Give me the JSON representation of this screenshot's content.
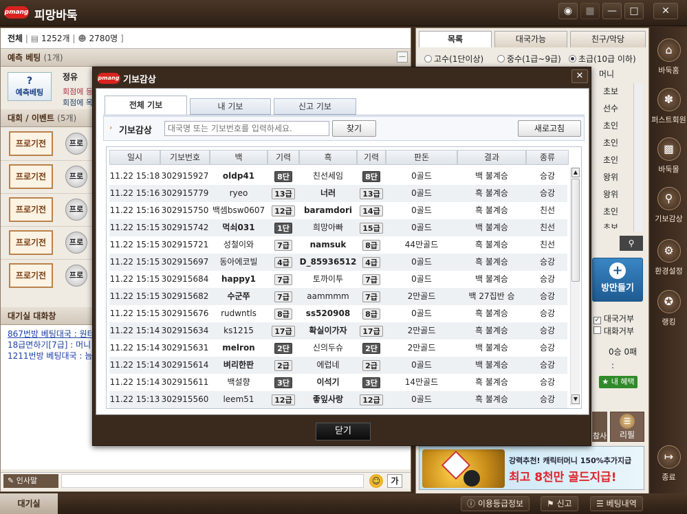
{
  "app": {
    "logo": "pmang",
    "title": "피망바둑"
  },
  "window_buttons": [
    "camera-icon",
    "grid-icon",
    "minimize-icon",
    "maximize-icon",
    "close-icon"
  ],
  "lobby": {
    "header_all": "전체",
    "count_label": "1252개",
    "user_label": "2780명",
    "prediction_title": "예측 베팅",
    "prediction_count": "(1개)",
    "prediction_button": "예측베팅",
    "prediction_user": "정유",
    "prediction_lines": [
      "회점에 등",
      "회점에 목"
    ],
    "events_title": "대회 / 이벤트",
    "events_count": "(5개)",
    "pro_buttons": [
      "프로기전",
      "프로기전",
      "프로기전",
      "프로기전",
      "프로기전"
    ],
    "pro_circles": [
      "프로",
      "프로",
      "프로",
      "프로",
      "프로"
    ],
    "chat_title": "대기실 대화창",
    "chat_lines": [
      "867번방 베팅대국 : 원터",
      "18급면하기[7급] : 머니",
      "1211번방 베팅대국 : 늠"
    ],
    "chat_input_label": "인사말",
    "chat_font_btn": "가",
    "footer_tab": "대기실"
  },
  "right": {
    "tabs": [
      "목록",
      "대국가능",
      "친구/악당"
    ],
    "filters": [
      {
        "label": "고수(1단이상)",
        "on": false
      },
      {
        "label": "중수(1급~9급)",
        "on": false
      },
      {
        "label": "초급(10급 이하)",
        "on": true
      }
    ],
    "col_header": "머니",
    "ranks": [
      "초보",
      "선수",
      "초인",
      "초인",
      "초인",
      "왕위",
      "왕위",
      "초인",
      "초보"
    ],
    "create_room": "방만들기",
    "check_refuse": "대국거부",
    "check_chat": "대화거부",
    "record_line": "0승 0패",
    "colon": ":",
    "benefit": "내 혜택",
    "btn_left": "참사",
    "btn_right": "리필",
    "ad_line1": "강력추천! 캐릭터머니 150%추가지급",
    "ad_line2": "최고 8천만 골드지급!"
  },
  "sidebar": [
    {
      "label": "바둑홈",
      "icon": "home-icon"
    },
    {
      "label": "퍼스트회원",
      "icon": "fan-icon"
    },
    {
      "label": "바둑몰",
      "icon": "gift-icon"
    },
    {
      "label": "기보감상",
      "icon": "magnifier-icon"
    },
    {
      "label": "환경설정",
      "icon": "settings-icon"
    },
    {
      "label": "랭킹",
      "icon": "medal-icon"
    },
    {
      "label": "종료",
      "icon": "exit-icon"
    }
  ],
  "bottom": {
    "grade_info": "이용등급정보",
    "report": "신고",
    "bet_history": "베팅내역"
  },
  "modal": {
    "logo": "pmang",
    "title": "기보감상",
    "tabs": [
      "전체 기보",
      "내 기보",
      "신고 기보"
    ],
    "search_label": "기보감상",
    "search_placeholder": "대국명 또는 기보번호를 입력하세요.",
    "search_button": "찾기",
    "refresh_button": "새로고침",
    "close_button": "닫기",
    "columns": [
      "일시",
      "기보번호",
      "백",
      "기력",
      "흑",
      "기력",
      "판돈",
      "결과",
      "종류"
    ],
    "rows": [
      {
        "date": "11.22 15:18",
        "id": "302915927",
        "white": "oldp41",
        "wrank": "8단",
        "black": "친선세임",
        "brank": "8단",
        "stake": "0골드",
        "result": "백 불계승",
        "type": "승강",
        "wbold": true,
        "bbold": false
      },
      {
        "date": "11.22 15:16",
        "id": "302915779",
        "white": "ryeo",
        "wrank": "13급",
        "black": "너러",
        "brank": "13급",
        "stake": "0골드",
        "result": "흑 불계승",
        "type": "승강",
        "wbold": false,
        "bbold": true
      },
      {
        "date": "11.22 15:16",
        "id": "302915750",
        "white": "백셈bsw0607",
        "wrank": "12급",
        "black": "baramdori",
        "brank": "14급",
        "stake": "0골드",
        "result": "흑 불계승",
        "type": "친선",
        "wbold": false,
        "bbold": true
      },
      {
        "date": "11.22 15:15",
        "id": "302915742",
        "white": "먹쇠031",
        "wrank": "1단",
        "black": "희망아빠",
        "brank": "15급",
        "stake": "0골드",
        "result": "백 불계승",
        "type": "친선",
        "wbold": true,
        "bbold": false
      },
      {
        "date": "11.22 15:15",
        "id": "302915721",
        "white": "성철이와",
        "wrank": "7급",
        "black": "namsuk",
        "brank": "8급",
        "stake": "44만골드",
        "result": "흑 불계승",
        "type": "친선",
        "wbold": false,
        "bbold": true
      },
      {
        "date": "11.22 15:15",
        "id": "302915697",
        "white": "동아에코빌",
        "wrank": "4급",
        "black": "D_85936512",
        "brank": "4급",
        "stake": "0골드",
        "result": "흑 불계승",
        "type": "승강",
        "wbold": false,
        "bbold": true
      },
      {
        "date": "11.22 15:15",
        "id": "302915684",
        "white": "happy1",
        "wrank": "7급",
        "black": "토까이투",
        "brank": "7급",
        "stake": "0골드",
        "result": "백 불계승",
        "type": "승강",
        "wbold": true,
        "bbold": false
      },
      {
        "date": "11.22 15:15",
        "id": "302915682",
        "white": "수군쭈",
        "wrank": "7급",
        "black": "aammmm",
        "brank": "7급",
        "stake": "2만골드",
        "result": "백 27집반 승",
        "type": "승강",
        "wbold": true,
        "bbold": false
      },
      {
        "date": "11.22 15:15",
        "id": "302915676",
        "white": "rudwntls",
        "wrank": "8급",
        "black": "ss520908",
        "brank": "8급",
        "stake": "0골드",
        "result": "흑 불계승",
        "type": "승강",
        "wbold": false,
        "bbold": true
      },
      {
        "date": "11.22 15:14",
        "id": "302915634",
        "white": "ks1215",
        "wrank": "17급",
        "black": "확실이가자",
        "brank": "17급",
        "stake": "2만골드",
        "result": "흑 불계승",
        "type": "승강",
        "wbold": false,
        "bbold": true
      },
      {
        "date": "11.22 15:14",
        "id": "302915631",
        "white": "melron",
        "wrank": "2단",
        "black": "신의두슈",
        "brank": "2단",
        "stake": "2만골드",
        "result": "백 불계승",
        "type": "승강",
        "wbold": true,
        "bbold": false
      },
      {
        "date": "11.22 15:14",
        "id": "302915614",
        "white": "벼리한판",
        "wrank": "2급",
        "black": "에럽네",
        "brank": "2급",
        "stake": "0골드",
        "result": "백 불계승",
        "type": "승강",
        "wbold": true,
        "bbold": false
      },
      {
        "date": "11.22 15:14",
        "id": "302915611",
        "white": "백설향",
        "wrank": "3단",
        "black": "이석기",
        "brank": "3단",
        "stake": "14만골드",
        "result": "흑 불계승",
        "type": "승강",
        "wbold": false,
        "bbold": true
      },
      {
        "date": "11.22 15:13",
        "id": "302915560",
        "white": "leem51",
        "wrank": "12급",
        "black": "좋잎사랑",
        "brank": "12급",
        "stake": "0골드",
        "result": "흑 불계승",
        "type": "승강",
        "wbold": false,
        "bbold": true
      }
    ]
  }
}
